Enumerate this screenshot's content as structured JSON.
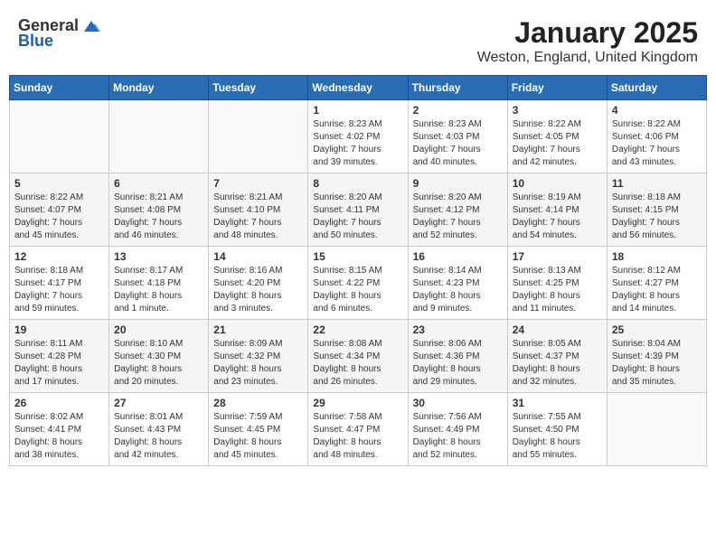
{
  "header": {
    "logo_general": "General",
    "logo_blue": "Blue",
    "month_year": "January 2025",
    "location": "Weston, England, United Kingdom"
  },
  "weekdays": [
    "Sunday",
    "Monday",
    "Tuesday",
    "Wednesday",
    "Thursday",
    "Friday",
    "Saturday"
  ],
  "weeks": [
    [
      {
        "day": null,
        "info": ""
      },
      {
        "day": null,
        "info": ""
      },
      {
        "day": null,
        "info": ""
      },
      {
        "day": "1",
        "info": "Sunrise: 8:23 AM\nSunset: 4:02 PM\nDaylight: 7 hours\nand 39 minutes."
      },
      {
        "day": "2",
        "info": "Sunrise: 8:23 AM\nSunset: 4:03 PM\nDaylight: 7 hours\nand 40 minutes."
      },
      {
        "day": "3",
        "info": "Sunrise: 8:22 AM\nSunset: 4:05 PM\nDaylight: 7 hours\nand 42 minutes."
      },
      {
        "day": "4",
        "info": "Sunrise: 8:22 AM\nSunset: 4:06 PM\nDaylight: 7 hours\nand 43 minutes."
      }
    ],
    [
      {
        "day": "5",
        "info": "Sunrise: 8:22 AM\nSunset: 4:07 PM\nDaylight: 7 hours\nand 45 minutes."
      },
      {
        "day": "6",
        "info": "Sunrise: 8:21 AM\nSunset: 4:08 PM\nDaylight: 7 hours\nand 46 minutes."
      },
      {
        "day": "7",
        "info": "Sunrise: 8:21 AM\nSunset: 4:10 PM\nDaylight: 7 hours\nand 48 minutes."
      },
      {
        "day": "8",
        "info": "Sunrise: 8:20 AM\nSunset: 4:11 PM\nDaylight: 7 hours\nand 50 minutes."
      },
      {
        "day": "9",
        "info": "Sunrise: 8:20 AM\nSunset: 4:12 PM\nDaylight: 7 hours\nand 52 minutes."
      },
      {
        "day": "10",
        "info": "Sunrise: 8:19 AM\nSunset: 4:14 PM\nDaylight: 7 hours\nand 54 minutes."
      },
      {
        "day": "11",
        "info": "Sunrise: 8:18 AM\nSunset: 4:15 PM\nDaylight: 7 hours\nand 56 minutes."
      }
    ],
    [
      {
        "day": "12",
        "info": "Sunrise: 8:18 AM\nSunset: 4:17 PM\nDaylight: 7 hours\nand 59 minutes."
      },
      {
        "day": "13",
        "info": "Sunrise: 8:17 AM\nSunset: 4:18 PM\nDaylight: 8 hours\nand 1 minute."
      },
      {
        "day": "14",
        "info": "Sunrise: 8:16 AM\nSunset: 4:20 PM\nDaylight: 8 hours\nand 3 minutes."
      },
      {
        "day": "15",
        "info": "Sunrise: 8:15 AM\nSunset: 4:22 PM\nDaylight: 8 hours\nand 6 minutes."
      },
      {
        "day": "16",
        "info": "Sunrise: 8:14 AM\nSunset: 4:23 PM\nDaylight: 8 hours\nand 9 minutes."
      },
      {
        "day": "17",
        "info": "Sunrise: 8:13 AM\nSunset: 4:25 PM\nDaylight: 8 hours\nand 11 minutes."
      },
      {
        "day": "18",
        "info": "Sunrise: 8:12 AM\nSunset: 4:27 PM\nDaylight: 8 hours\nand 14 minutes."
      }
    ],
    [
      {
        "day": "19",
        "info": "Sunrise: 8:11 AM\nSunset: 4:28 PM\nDaylight: 8 hours\nand 17 minutes."
      },
      {
        "day": "20",
        "info": "Sunrise: 8:10 AM\nSunset: 4:30 PM\nDaylight: 8 hours\nand 20 minutes."
      },
      {
        "day": "21",
        "info": "Sunrise: 8:09 AM\nSunset: 4:32 PM\nDaylight: 8 hours\nand 23 minutes."
      },
      {
        "day": "22",
        "info": "Sunrise: 8:08 AM\nSunset: 4:34 PM\nDaylight: 8 hours\nand 26 minutes."
      },
      {
        "day": "23",
        "info": "Sunrise: 8:06 AM\nSunset: 4:36 PM\nDaylight: 8 hours\nand 29 minutes."
      },
      {
        "day": "24",
        "info": "Sunrise: 8:05 AM\nSunset: 4:37 PM\nDaylight: 8 hours\nand 32 minutes."
      },
      {
        "day": "25",
        "info": "Sunrise: 8:04 AM\nSunset: 4:39 PM\nDaylight: 8 hours\nand 35 minutes."
      }
    ],
    [
      {
        "day": "26",
        "info": "Sunrise: 8:02 AM\nSunset: 4:41 PM\nDaylight: 8 hours\nand 38 minutes."
      },
      {
        "day": "27",
        "info": "Sunrise: 8:01 AM\nSunset: 4:43 PM\nDaylight: 8 hours\nand 42 minutes."
      },
      {
        "day": "28",
        "info": "Sunrise: 7:59 AM\nSunset: 4:45 PM\nDaylight: 8 hours\nand 45 minutes."
      },
      {
        "day": "29",
        "info": "Sunrise: 7:58 AM\nSunset: 4:47 PM\nDaylight: 8 hours\nand 48 minutes."
      },
      {
        "day": "30",
        "info": "Sunrise: 7:56 AM\nSunset: 4:49 PM\nDaylight: 8 hours\nand 52 minutes."
      },
      {
        "day": "31",
        "info": "Sunrise: 7:55 AM\nSunset: 4:50 PM\nDaylight: 8 hours\nand 55 minutes."
      },
      {
        "day": null,
        "info": ""
      }
    ]
  ]
}
